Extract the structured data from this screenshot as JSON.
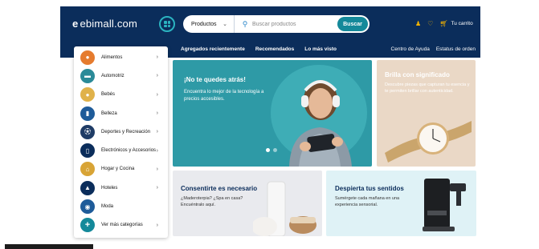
{
  "header": {
    "logo_mark": "e",
    "logo_text": "ebimall.com",
    "search": {
      "category": "Productos",
      "placeholder": "Buscar productos",
      "button": "Buscar"
    },
    "cart_label": "Tu carrito"
  },
  "nav": {
    "left": [
      "Agregados recientemente",
      "Recomendados",
      "Lo más visto"
    ],
    "right": [
      "Centro de Ayuda",
      "Estatus de orden"
    ]
  },
  "categories": [
    {
      "label": "Alimentos",
      "icon": "food-icon",
      "color": "#e57b2e",
      "chevron": "›"
    },
    {
      "label": "Automotriz",
      "icon": "car-icon",
      "color": "#2b8a98",
      "chevron": "›"
    },
    {
      "label": "Bebés",
      "icon": "baby-icon",
      "color": "#e0b24a",
      "chevron": "›"
    },
    {
      "label": "Belleza",
      "icon": "beauty-icon",
      "color": "#1e5b99",
      "chevron": "›"
    },
    {
      "label": "Deportes y Recreación",
      "icon": "soccer-icon",
      "color": "#1f3c66",
      "chevron": "›"
    },
    {
      "label": "Electrónicos y Accesorios",
      "icon": "electronics-icon",
      "color": "#0b2d5b",
      "chevron": "›"
    },
    {
      "label": "Hogar y Cocina",
      "icon": "home-icon",
      "color": "#d8a436",
      "chevron": "›"
    },
    {
      "label": "Hoteles",
      "icon": "hotel-icon",
      "color": "#0b2d5b",
      "chevron": "›"
    },
    {
      "label": "Moda",
      "icon": "fashion-icon",
      "color": "#1e5b99",
      "chevron": ""
    },
    {
      "label": "Ver más categorías",
      "icon": "plus-icon",
      "color": "#14899a",
      "chevron": "›"
    }
  ],
  "banners": {
    "hero": {
      "title": "¡No te quedes atrás!",
      "subtitle": "Encuentra lo mejor de la tecnología a precios accesibles."
    },
    "watch": {
      "title": "Brilla con significado",
      "subtitle": "Descubre piezas que capturan tu esencia y te permiten brillar con autenticidad."
    },
    "spa": {
      "title": "Consentirte es necesario",
      "subtitle": "¿Maderoterpia? ¿Spa en casa? Encuéntralo aquí."
    },
    "coffee": {
      "title": "Despierta tus sentidos",
      "subtitle": "Sumérgete cada mañana en una experiencia sensorial."
    }
  },
  "colors": {
    "navy": "#0b2d5b",
    "teal": "#14899a",
    "accent": "#f5b400"
  }
}
